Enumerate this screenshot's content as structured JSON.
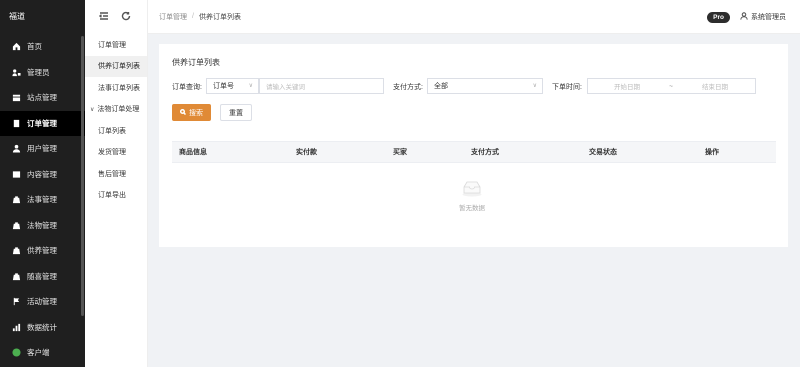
{
  "app": {
    "logo": "福道"
  },
  "sidebar": {
    "items": [
      {
        "label": "首页",
        "icon": "home-icon",
        "active": false
      },
      {
        "label": "管理员",
        "icon": "admin-icon",
        "active": false
      },
      {
        "label": "站点管理",
        "icon": "site-icon",
        "active": false
      },
      {
        "label": "订单管理",
        "icon": "order-icon",
        "active": true
      },
      {
        "label": "用户管理",
        "icon": "user-icon",
        "active": false
      },
      {
        "label": "内容管理",
        "icon": "content-icon",
        "active": false
      },
      {
        "label": "法事管理",
        "icon": "ritual-icon",
        "active": false
      },
      {
        "label": "法物管理",
        "icon": "artifact-icon",
        "active": false
      },
      {
        "label": "供养管理",
        "icon": "offering-icon",
        "active": false
      },
      {
        "label": "随喜管理",
        "icon": "donation-icon",
        "active": false
      },
      {
        "label": "活动管理",
        "icon": "flag-icon",
        "active": false
      },
      {
        "label": "数据统计",
        "icon": "chart-icon",
        "active": false
      },
      {
        "label": "客户端",
        "icon": "client-icon",
        "active": false
      }
    ]
  },
  "submenu": {
    "items": [
      {
        "label": "订单管理",
        "active": false,
        "group": false
      },
      {
        "label": "供养订单列表",
        "active": true,
        "group": false
      },
      {
        "label": "法事订单列表",
        "active": false,
        "group": false
      },
      {
        "label": "法物订单处理",
        "active": false,
        "group": true
      },
      {
        "label": "订单列表",
        "active": false,
        "group": false
      },
      {
        "label": "发货管理",
        "active": false,
        "group": false
      },
      {
        "label": "售后管理",
        "active": false,
        "group": false
      },
      {
        "label": "订单导出",
        "active": false,
        "group": false
      }
    ]
  },
  "header": {
    "breadcrumb": [
      "订单管理",
      "供养订单列表"
    ],
    "separator": "/",
    "pro_badge": "Pro",
    "username": "系统管理员"
  },
  "panel": {
    "title": "供养订单列表",
    "filters": {
      "query_label": "订单查询:",
      "query_type": "订单号",
      "query_placeholder": "请输入关键词",
      "payment_label": "支付方式:",
      "payment_value": "全部",
      "time_label": "下单时间:",
      "start_placeholder": "开始日期",
      "range_sep": "~",
      "end_placeholder": "结束日期"
    },
    "buttons": {
      "search": "搜索",
      "reset": "重置"
    },
    "table": {
      "columns": [
        "商品信息",
        "实付款",
        "买家",
        "支付方式",
        "交易状态",
        "操作"
      ],
      "empty_text": "暂无数据"
    }
  },
  "colors": {
    "accent": "#e08a36",
    "sidebar_bg": "#1f1f1f",
    "active_bg": "#000000"
  }
}
